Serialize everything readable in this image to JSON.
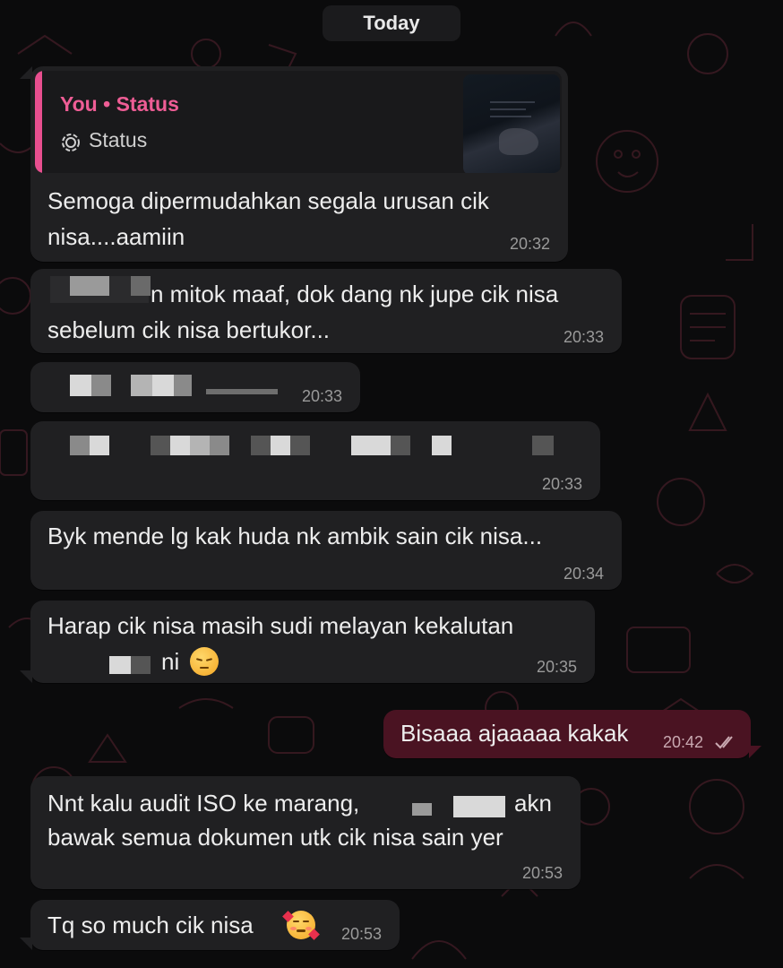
{
  "date_separator": "Today",
  "colors": {
    "accent": "#e84f8f",
    "incoming_bubble": "#202022",
    "outgoing_bubble": "#4a1322",
    "background": "#0b0b0c"
  },
  "messages": [
    {
      "direction": "incoming",
      "reply_to": {
        "sender": "You • Status",
        "type_label": "Status",
        "type_icon": "status-ring-icon"
      },
      "lines": [
        "Semoga dipermudahkan segala urusan cik",
        "nisa....aamiin"
      ],
      "time": "20:32"
    },
    {
      "direction": "incoming",
      "lines": [
        "n mitok maaf, dok dang nk jupe cik nisa",
        "sebelum cik nisa bertukor..."
      ],
      "time": "20:33",
      "partially_redacted": true
    },
    {
      "direction": "incoming",
      "lines": [],
      "time": "20:33",
      "partially_redacted": true
    },
    {
      "direction": "incoming",
      "lines": [],
      "time": "20:33",
      "partially_redacted": true
    },
    {
      "direction": "incoming",
      "lines": [
        "Byk mende lg kak huda nk ambik sain cik nisa..."
      ],
      "time": "20:34"
    },
    {
      "direction": "incoming",
      "lines": [
        "Harap cik nisa masih sudi melayan kekalutan",
        "ni"
      ],
      "emoji": "pensive-face-emoji",
      "time": "20:35",
      "partially_redacted": true
    },
    {
      "direction": "outgoing",
      "lines": [
        "Bisaaa ajaaaaa kakak"
      ],
      "time": "20:42",
      "status_icon": "double-check-read-icon"
    },
    {
      "direction": "incoming",
      "lines": [
        "Nnt kalu audit ISO ke marang,",
        "akn",
        "bawak semua dokumen utk cik nisa sain yer"
      ],
      "time": "20:53",
      "partially_redacted": true
    },
    {
      "direction": "incoming",
      "lines": [
        "Tq so much cik nisa"
      ],
      "emoji": "smiling-face-with-hearts-emoji",
      "time": "20:53"
    }
  ]
}
